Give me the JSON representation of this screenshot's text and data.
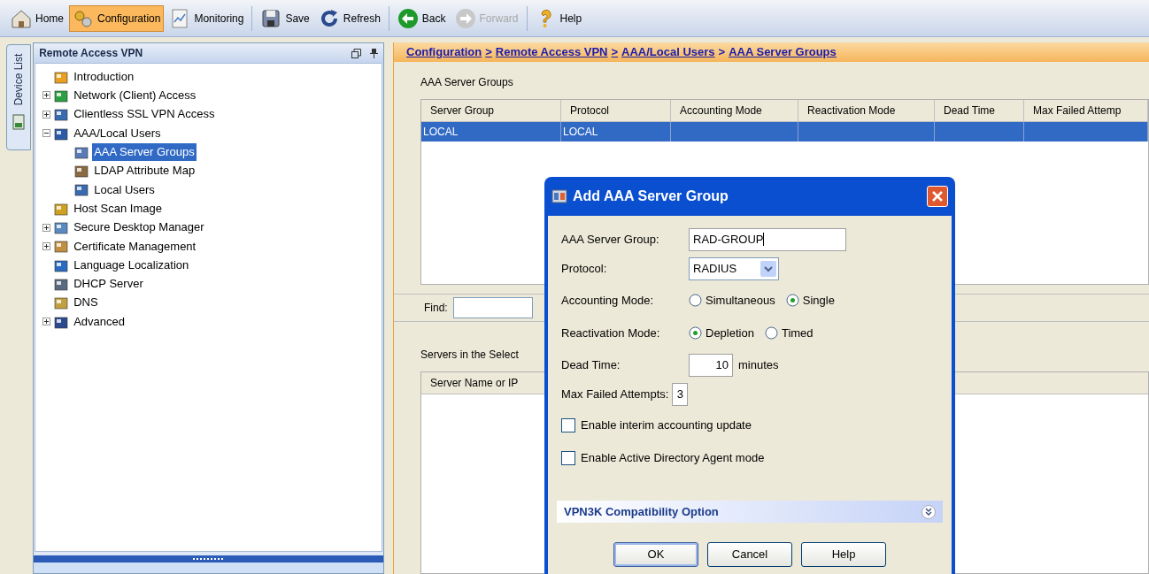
{
  "toolbar": [
    {
      "label": "Home",
      "selected": false,
      "disabled": false
    },
    {
      "label": "Configuration",
      "selected": true,
      "disabled": false
    },
    {
      "label": "Monitoring",
      "selected": false,
      "disabled": false
    },
    {
      "label": "Save",
      "selected": false,
      "disabled": false
    },
    {
      "label": "Refresh",
      "selected": false,
      "disabled": false
    },
    {
      "label": "Back",
      "selected": false,
      "disabled": false
    },
    {
      "label": "Forward",
      "selected": false,
      "disabled": true
    },
    {
      "label": "Help",
      "selected": false,
      "disabled": false
    }
  ],
  "side_tab": {
    "label": "Device List"
  },
  "sidebar": {
    "title": "Remote Access VPN",
    "items": [
      {
        "label": "Introduction",
        "kind": "leaf",
        "selected": false
      },
      {
        "label": "Network (Client) Access",
        "kind": "folder",
        "expanded": false,
        "selected": false
      },
      {
        "label": "Clientless SSL VPN Access",
        "kind": "folder",
        "expanded": false,
        "selected": false
      },
      {
        "label": "AAA/Local Users",
        "kind": "folder",
        "expanded": true,
        "selected": false,
        "children": [
          {
            "label": "AAA Server Groups",
            "kind": "leaf",
            "selected": true
          },
          {
            "label": "LDAP Attribute Map",
            "kind": "leaf",
            "selected": false
          },
          {
            "label": "Local Users",
            "kind": "leaf",
            "selected": false
          }
        ]
      },
      {
        "label": "Host Scan Image",
        "kind": "leaf",
        "selected": false
      },
      {
        "label": "Secure Desktop Manager",
        "kind": "folder",
        "expanded": false,
        "selected": false
      },
      {
        "label": "Certificate Management",
        "kind": "folder",
        "expanded": false,
        "selected": false
      },
      {
        "label": "Language Localization",
        "kind": "leaf",
        "selected": false
      },
      {
        "label": "DHCP Server",
        "kind": "leaf",
        "selected": false
      },
      {
        "label": "DNS",
        "kind": "leaf",
        "selected": false
      },
      {
        "label": "Advanced",
        "kind": "folder",
        "expanded": false,
        "selected": false
      }
    ]
  },
  "breadcrumb": {
    "separator": ">",
    "items": [
      "Configuration",
      "Remote Access VPN",
      "AAA/Local Users",
      "AAA Server Groups"
    ]
  },
  "groups_table": {
    "title": "AAA Server Groups",
    "columns": [
      "Server Group",
      "Protocol",
      "Accounting Mode",
      "Reactivation Mode",
      "Dead Time",
      "Max Failed Attemp"
    ],
    "rows": [
      {
        "cells": [
          "LOCAL",
          "LOCAL"
        ],
        "selected": true
      }
    ]
  },
  "find": {
    "label": "Find:"
  },
  "servers_table": {
    "title": "Servers in the Select",
    "columns": [
      "Server Name or IP"
    ]
  },
  "dialog": {
    "title": "Add AAA Server Group",
    "server_group": {
      "label": "AAA Server Group:",
      "value": "RAD-GROUP"
    },
    "protocol": {
      "label": "Protocol:",
      "value": "RADIUS"
    },
    "accounting_mode": {
      "label": "Accounting Mode:",
      "options": [
        {
          "label": "Simultaneous",
          "selected": false
        },
        {
          "label": "Single",
          "selected": true
        }
      ]
    },
    "reactivation_mode": {
      "label": "Reactivation Mode:",
      "options": [
        {
          "label": "Depletion",
          "selected": true
        },
        {
          "label": "Timed",
          "selected": false
        }
      ]
    },
    "dead_time": {
      "label": "Dead Time:",
      "value": "10",
      "unit": "minutes"
    },
    "max_failed": {
      "label": "Max Failed Attempts:",
      "value": "3"
    },
    "checkboxes": [
      {
        "label": "Enable interim accounting update",
        "checked": false
      },
      {
        "label": "Enable Active Directory Agent mode",
        "checked": false
      }
    ],
    "section": {
      "title": "VPN3K Compatibility Option",
      "expanded": false
    },
    "buttons": [
      "OK",
      "Cancel",
      "Help"
    ]
  }
}
